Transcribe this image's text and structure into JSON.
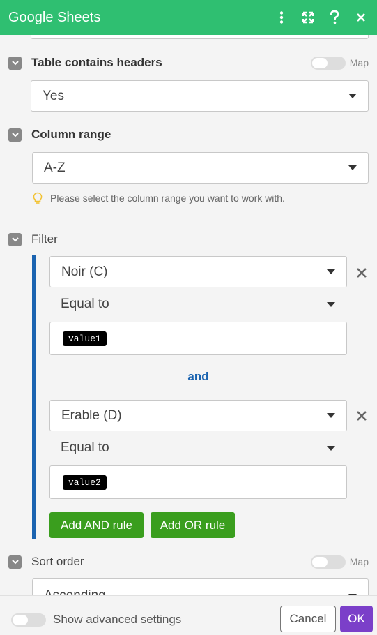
{
  "header": {
    "title": "Google Sheets",
    "icons": [
      "kebab-menu-icon",
      "expand-icon",
      "help-icon",
      "close-icon"
    ]
  },
  "fields": {
    "table_headers": {
      "label": "Table contains headers",
      "value": "Yes",
      "map_label": "Map"
    },
    "column_range": {
      "label": "Column range",
      "value": "A-Z",
      "hint": "Please select the column range you want to work with."
    },
    "filter": {
      "label": "Filter",
      "rules": [
        {
          "column": "Noir (C)",
          "operator": "Equal to",
          "value": "value1"
        },
        {
          "column": "Erable (D)",
          "operator": "Equal to",
          "value": "value2"
        }
      ],
      "joiner": "and",
      "add_and_label": "Add AND rule",
      "add_or_label": "Add OR rule"
    },
    "sort_order": {
      "label": "Sort order",
      "value": "Ascending",
      "map_label": "Map"
    }
  },
  "footer": {
    "advanced_label": "Show advanced settings",
    "cancel_label": "Cancel",
    "ok_label": "OK"
  },
  "colors": {
    "header_bg": "#2fbf71",
    "filter_bar": "#1a63b0",
    "rule_button": "#3a9e1e",
    "ok_button": "#7b3fc9"
  }
}
